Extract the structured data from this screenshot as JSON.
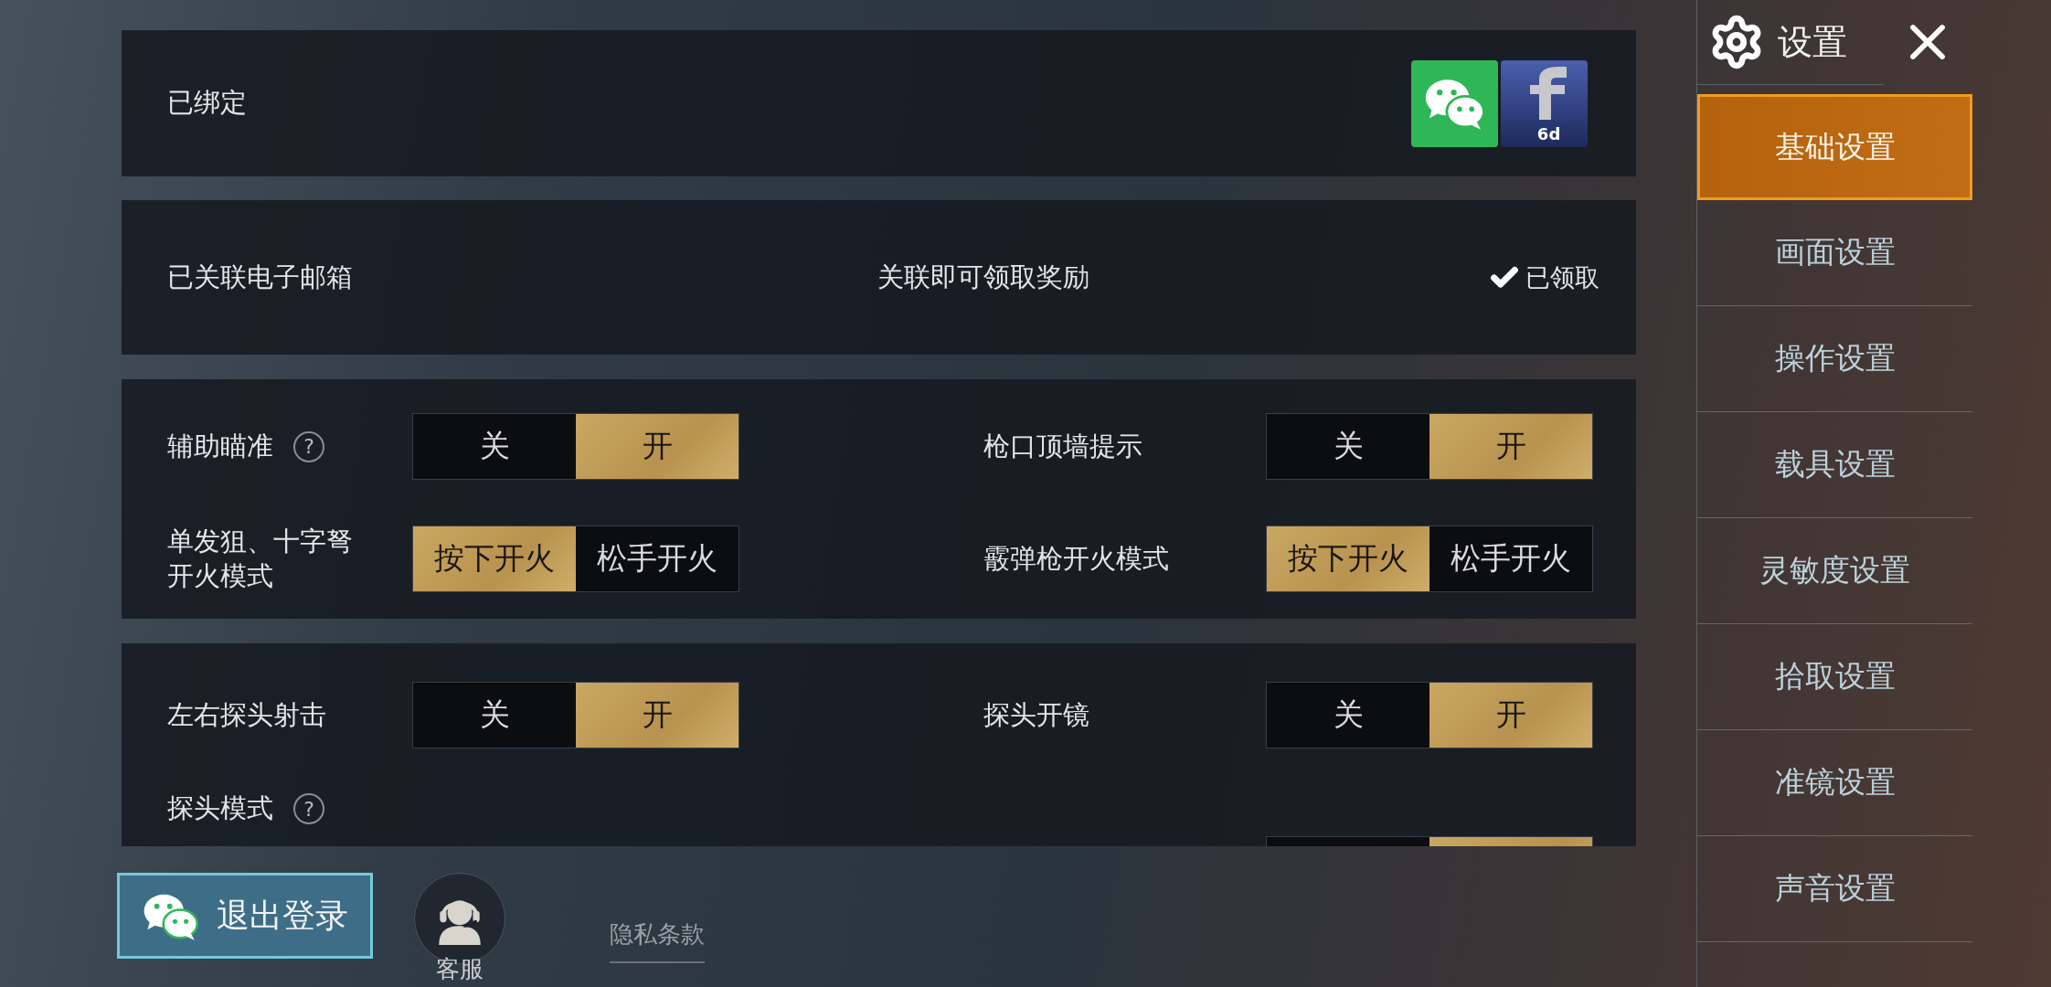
{
  "header": {
    "title": "设置"
  },
  "sidebar": {
    "items": [
      {
        "label": "基础设置",
        "selected": true
      },
      {
        "label": "画面设置",
        "selected": false
      },
      {
        "label": "操作设置",
        "selected": false
      },
      {
        "label": "载具设置",
        "selected": false
      },
      {
        "label": "灵敏度设置",
        "selected": false
      },
      {
        "label": "拾取设置",
        "selected": false
      },
      {
        "label": "准镜设置",
        "selected": false
      },
      {
        "label": "声音设置",
        "selected": false
      }
    ]
  },
  "bound": {
    "label": "已绑定",
    "accounts": [
      {
        "kind": "wechat"
      },
      {
        "kind": "facebook",
        "badge": "6d"
      }
    ]
  },
  "email": {
    "label": "已关联电子邮箱",
    "hint": "关联即可领取奖励",
    "status": "已领取",
    "claimed": true
  },
  "groups": [
    {
      "rows": [
        {
          "left": {
            "kind": "toggle",
            "label": "辅助瞄准",
            "help": "?",
            "options": [
              {
                "label": "关",
                "selected": false
              },
              {
                "label": "开",
                "selected": true
              }
            ]
          },
          "right": {
            "kind": "toggle",
            "label": "枪口顶墙提示",
            "options": [
              {
                "label": "关",
                "selected": false
              },
              {
                "label": "开",
                "selected": true
              }
            ]
          }
        },
        {
          "left": {
            "kind": "toggle",
            "label": "单发狙、十字弩开火模式",
            "options": [
              {
                "label": "按下开火",
                "selected": true
              },
              {
                "label": "松手开火",
                "selected": false
              }
            ]
          },
          "right": {
            "kind": "toggle",
            "label": "霰弹枪开火模式",
            "options": [
              {
                "label": "按下开火",
                "selected": true
              },
              {
                "label": "松手开火",
                "selected": false
              }
            ]
          }
        }
      ]
    },
    {
      "rows": [
        {
          "left": {
            "kind": "toggle",
            "label": "左右探头射击",
            "options": [
              {
                "label": "关",
                "selected": false
              },
              {
                "label": "开",
                "selected": true
              }
            ]
          },
          "right": {
            "kind": "toggle",
            "label": "探头开镜",
            "options": [
              {
                "label": "关",
                "selected": false
              },
              {
                "label": "开",
                "selected": true
              }
            ]
          }
        },
        {
          "left": {
            "kind": "heading",
            "label": "探头模式",
            "help": "?"
          }
        },
        {
          "right": {
            "kind": "toggle",
            "options": [
              {
                "selected": false
              },
              {
                "selected": true
              }
            ]
          }
        }
      ]
    }
  ],
  "footer": {
    "logout": "退出登录",
    "support": "客服",
    "privacy": "隐私条款"
  }
}
